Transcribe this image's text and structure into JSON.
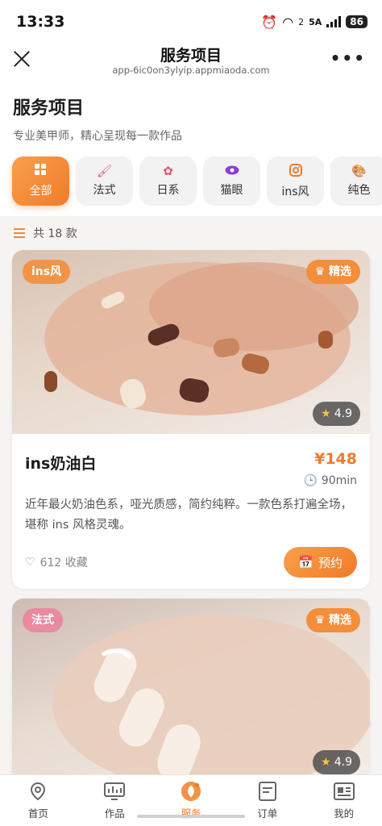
{
  "status": {
    "time": "13:33",
    "network": "5A",
    "signal_sup": "2",
    "battery": "86"
  },
  "nav": {
    "title": "服务项目",
    "url": "app-6ic0on3ylyip.appmiaoda.com"
  },
  "header": {
    "title": "服务项目",
    "subtitle": "专业美甲师，精心呈现每一款作品"
  },
  "categories": [
    {
      "label": "全部",
      "icon": "grid-icon",
      "active": true
    },
    {
      "label": "法式",
      "icon": "brush-icon",
      "active": false
    },
    {
      "label": "日系",
      "icon": "flower-icon",
      "active": false
    },
    {
      "label": "猫眼",
      "icon": "eye-icon",
      "active": false
    },
    {
      "label": "ins风",
      "icon": "instagram-icon",
      "active": false
    },
    {
      "label": "纯色",
      "icon": "palette-icon",
      "active": false
    }
  ],
  "count_text": "共 18 款",
  "cards": [
    {
      "style_badge": "ins风",
      "pick_badge": "精选",
      "rating": "4.9",
      "name": "ins奶油白",
      "price": "¥148",
      "duration": "90min",
      "description": "近年最火奶油色系，哑光质感，简约纯粹。一款色系打遍全场，堪称 ins 风格灵魂。",
      "favorites": "612 收藏",
      "book_label": "预约"
    },
    {
      "style_badge": "法式",
      "pick_badge": "精选",
      "rating": "4.9"
    }
  ],
  "tabs": [
    {
      "label": "首页",
      "icon": "home-pin-icon"
    },
    {
      "label": "作品",
      "icon": "gallery-icon"
    },
    {
      "label": "服务",
      "icon": "service-icon",
      "active": true
    },
    {
      "label": "订单",
      "icon": "order-icon"
    },
    {
      "label": "我的",
      "icon": "profile-icon"
    }
  ],
  "colors": {
    "accent": "#ef7b2a",
    "accent_light": "#f9a04a",
    "french_badge": "#e88aa0"
  }
}
